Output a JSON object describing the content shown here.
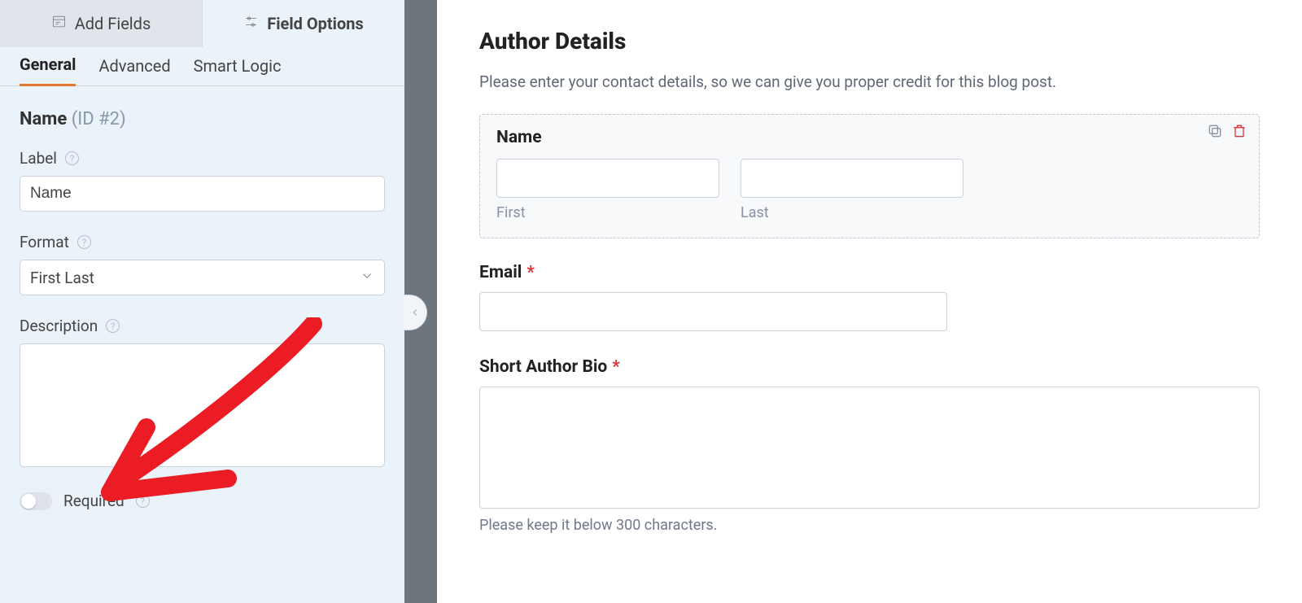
{
  "sidebar": {
    "top_tabs": {
      "add_fields": "Add Fields",
      "field_options": "Field Options"
    },
    "sub_tabs": {
      "general": "General",
      "advanced": "Advanced",
      "smart_logic": "Smart Logic"
    },
    "field_header": {
      "name": "Name",
      "id_text": "(ID #2)"
    },
    "label_section": {
      "title": "Label",
      "value": "Name"
    },
    "format_section": {
      "title": "Format",
      "value": "First Last"
    },
    "description_section": {
      "title": "Description",
      "value": ""
    },
    "required": {
      "label": "Required",
      "on": false
    }
  },
  "preview": {
    "heading": "Author Details",
    "desc": "Please enter your contact details, so we can give you proper credit for this blog post.",
    "name_field": {
      "label": "Name",
      "sub_first": "First",
      "sub_last": "Last"
    },
    "email_field": {
      "label": "Email",
      "required": true
    },
    "bio_field": {
      "label": "Short Author Bio",
      "required": true,
      "helper": "Please keep it below 300 characters."
    }
  },
  "colors": {
    "accent": "#E27730",
    "danger": "#D63638",
    "annotation": "#EC1C24"
  }
}
